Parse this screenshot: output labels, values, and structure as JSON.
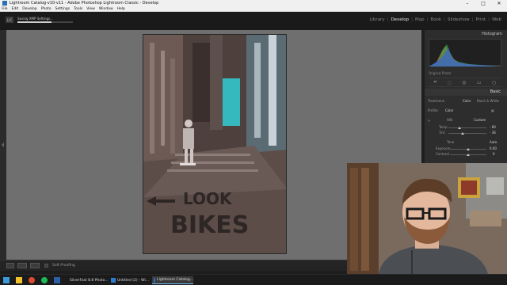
{
  "window": {
    "title": "Lightroom Catalog-v10-v11 - Adobe Photoshop Lightroom Classic - Develop",
    "controls": {
      "minimize": "–",
      "maximize": "□",
      "close": "✕"
    }
  },
  "menu": [
    "File",
    "Edit",
    "Develop",
    "Photo",
    "Settings",
    "Tools",
    "View",
    "Window",
    "Help"
  ],
  "lightroom": {
    "logo": "LrC",
    "status_text": "Saving XMP Settings...",
    "progress_fraction": 0.62,
    "modules": [
      "Library",
      "Develop",
      "Map",
      "Book",
      "Slideshow",
      "Print",
      "Web"
    ],
    "active_module": "Develop"
  },
  "photo": {
    "street_text_1": "LOOK",
    "street_text_2": "BIKES"
  },
  "toolbar": {
    "soft_proofing_label": "Soft Proofing"
  },
  "right_panel": {
    "histogram_title": "Histogram",
    "original_photo_label": "Original Photo",
    "basic_title": "Basic",
    "treatment_label": "Treatment:",
    "color_label": "Color",
    "bw_label": "Black & White",
    "profile_label": "Profile:",
    "profile_value": "Color",
    "wb_label": "WB:",
    "wb_value": "Custom",
    "temp_label": "Temp",
    "temp_value": "- 60",
    "tint_label": "Tint",
    "tint_value": "- 36",
    "tone_label": "Tone",
    "auto_label": "Auto",
    "exposure_label": "Exposure",
    "exposure_value": "0.00",
    "contrast_label": "Contrast",
    "contrast_value": "0"
  },
  "taskbar": {
    "items": [
      {
        "label": "SilverFast 8.8 Photo..."
      },
      {
        "label": "Untitled (2) - Wi..."
      },
      {
        "label": "Lightroom Catalog..."
      }
    ],
    "active_index": 2
  },
  "colors": {
    "lr_dark": "#1a1a1a",
    "canvas_gray": "#6f6f6f",
    "panel_gray": "#2d2d2d",
    "taskbar_accent": "#76b9ed"
  }
}
